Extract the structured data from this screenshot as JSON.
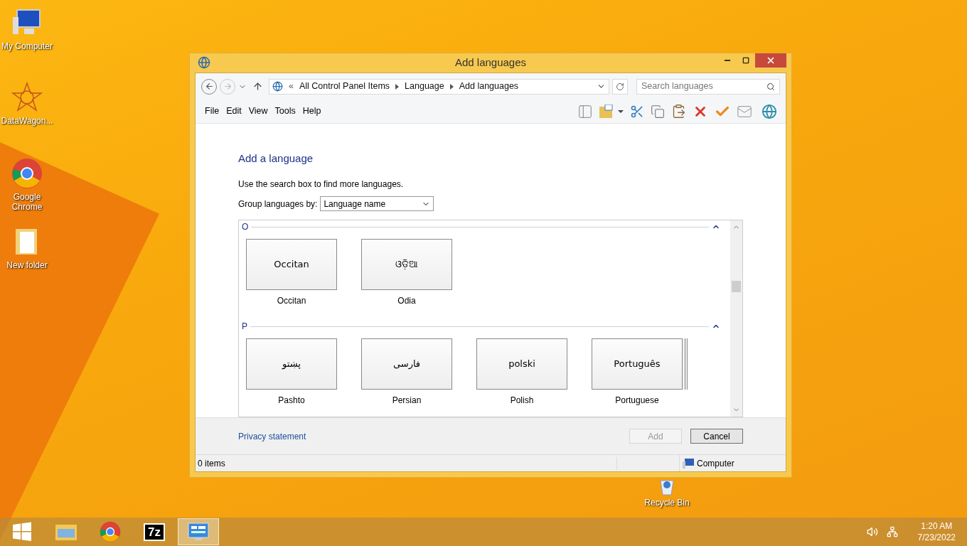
{
  "desktop_icons": [
    {
      "kind": "computer",
      "label": "My Computer"
    },
    {
      "kind": "star",
      "label": "DataWagon..."
    },
    {
      "kind": "chrome",
      "label": "Google Chrome"
    },
    {
      "kind": "folder",
      "label": "New folder"
    },
    {
      "kind": "recycle",
      "label": "Recycle Bin"
    }
  ],
  "window": {
    "title": "Add languages",
    "breadcrumb": {
      "prefix": "«",
      "items": [
        "All Control Panel Items",
        "Language",
        "Add languages"
      ]
    },
    "search": {
      "placeholder": "Search languages"
    },
    "menu": [
      "File",
      "Edit",
      "View",
      "Tools",
      "Help"
    ],
    "heading": "Add a language",
    "hint": "Use the search box to find more languages.",
    "group_by": {
      "label": "Group languages by:",
      "value": "Language name"
    },
    "groups": [
      {
        "letter": "O",
        "expanded": true,
        "languages": [
          {
            "native": "Occitan",
            "name": "Occitan",
            "stacked": false
          },
          {
            "native": "ଓଡ଼ିଆ",
            "name": "Odia",
            "stacked": false
          }
        ]
      },
      {
        "letter": "P",
        "expanded": true,
        "languages": [
          {
            "native": "پښتو",
            "name": "Pashto",
            "stacked": false
          },
          {
            "native": "فارسی",
            "name": "Persian",
            "stacked": false
          },
          {
            "native": "polski",
            "name": "Polish",
            "stacked": false
          },
          {
            "native": "Português",
            "name": "Portuguese",
            "stacked": true
          }
        ]
      }
    ],
    "privacy_link": "Privacy statement",
    "buttons": [
      {
        "label": "Add",
        "disabled": true
      },
      {
        "label": "Cancel",
        "disabled": false
      }
    ],
    "status_bar": {
      "items": "0 items",
      "location": "Computer"
    }
  },
  "taskbar": {
    "items": [
      {
        "kind": "start",
        "selected": false
      },
      {
        "kind": "explorer",
        "selected": false
      },
      {
        "kind": "chrome",
        "selected": false
      },
      {
        "kind": "sevenzip",
        "label": "7z",
        "selected": false
      },
      {
        "kind": "control-panel",
        "selected": true
      }
    ],
    "time": "1:20 AM",
    "date": "7/23/2022"
  }
}
